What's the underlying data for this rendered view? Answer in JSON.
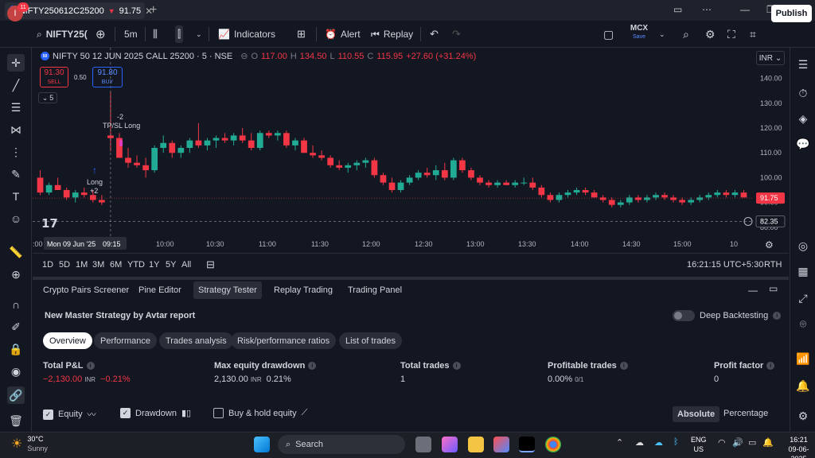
{
  "titlebar": {
    "tab_logo": "50",
    "tab_symbol": "NIFTY250612C25200",
    "tab_arrow": "▼",
    "tab_price": "91.75",
    "tab_close": "✕",
    "new_tab": "+"
  },
  "toolbar": {
    "avatar_letter": "I",
    "avatar_badge": "11",
    "symbol": "NIFTY25(",
    "interval": "5m",
    "indicators": "Indicators",
    "alert": "Alert",
    "replay": "Replay",
    "exchange": "MCX",
    "exchange_sub": "Save",
    "publish": "Publish"
  },
  "legend": {
    "logo": "50",
    "title": "NIFTY 50 12 JUN 2025 CALL 25200 · 5 · NSE",
    "o_label": "O",
    "o": "117.00",
    "h_label": "H",
    "h": "134.50",
    "l_label": "L",
    "l": "110.55",
    "c_label": "C",
    "c": "115.95",
    "change": "+27.60 (+31.24%)"
  },
  "trade": {
    "sell_price": "91.30",
    "sell_label": "SELL",
    "spread": "0.50",
    "buy_price": "91.80",
    "buy_label": "BUY",
    "collapse_count": "5"
  },
  "currency": "INR",
  "chart_data": {
    "type": "candlestick",
    "y_ticks": [
      "140.00",
      "130.00",
      "120.00",
      "110.00",
      "100.00",
      "90.00",
      "80.00"
    ],
    "x_ticks": [
      ":00",
      "Mon 09 Jun '25",
      "09:15",
      "10:00",
      "10:30",
      "11:00",
      "11:30",
      "12:00",
      "12:30",
      "13:00",
      "13:30",
      "14:00",
      "14:30",
      "15:00",
      "10"
    ],
    "ylim": [
      78,
      146
    ],
    "last_price": "91.75",
    "crosshair_price": "82.35",
    "annotations": {
      "tp_count": "-2",
      "tp_label": "TP/SL Long",
      "long_label": "Long",
      "long_count": "+2"
    },
    "candles": [
      [
        100,
        103,
        93,
        94
      ],
      [
        94,
        98,
        93,
        97
      ],
      [
        97,
        100,
        95,
        95
      ],
      [
        95,
        96,
        91,
        92
      ],
      [
        92,
        95,
        90,
        94
      ],
      [
        94,
        96,
        92,
        93
      ],
      [
        93,
        95,
        90,
        91
      ],
      [
        91,
        93,
        89,
        90
      ],
      [
        117,
        134.5,
        110.55,
        115.95
      ],
      [
        116,
        118,
        108,
        108
      ],
      [
        108,
        112,
        104,
        106
      ],
      [
        106,
        109,
        104,
        105
      ],
      [
        105,
        108,
        100,
        103
      ],
      [
        103,
        113,
        102,
        112
      ],
      [
        112,
        117,
        110,
        114
      ],
      [
        114,
        115,
        108,
        110
      ],
      [
        110,
        113,
        108,
        112
      ],
      [
        112,
        116,
        110,
        115
      ],
      [
        115,
        122,
        112,
        113
      ],
      [
        113,
        116,
        111,
        115
      ],
      [
        115,
        117,
        112,
        116
      ],
      [
        116,
        118,
        114,
        115
      ],
      [
        115,
        118,
        113,
        117
      ],
      [
        117,
        120,
        114,
        115
      ],
      [
        115,
        118,
        111,
        112
      ],
      [
        112,
        119,
        111,
        118
      ],
      [
        118,
        119,
        116,
        117
      ],
      [
        117,
        119,
        115,
        118
      ],
      [
        118,
        119,
        112,
        113
      ],
      [
        113,
        116,
        111,
        115
      ],
      [
        115,
        116,
        110,
        110
      ],
      [
        110,
        113,
        108,
        109
      ],
      [
        109,
        111,
        107,
        108
      ],
      [
        108,
        109,
        104,
        105
      ],
      [
        105,
        107,
        103,
        104
      ],
      [
        104,
        106,
        102,
        105
      ],
      [
        105,
        107,
        103,
        106
      ],
      [
        106,
        108,
        104,
        107
      ],
      [
        107,
        108,
        100,
        101
      ],
      [
        101,
        102,
        97,
        98
      ],
      [
        98,
        100,
        94,
        95
      ],
      [
        95,
        99,
        94,
        98
      ],
      [
        98,
        101,
        97,
        100
      ],
      [
        100,
        103,
        99,
        102
      ],
      [
        102,
        104,
        100,
        101
      ],
      [
        101,
        105,
        99,
        103
      ],
      [
        103,
        106,
        99,
        100
      ],
      [
        100,
        108,
        99,
        107
      ],
      [
        107,
        108,
        102,
        103
      ],
      [
        103,
        104,
        99,
        100
      ],
      [
        100,
        101,
        97,
        98
      ],
      [
        98,
        99,
        96,
        97
      ],
      [
        97,
        99,
        96,
        98
      ],
      [
        98,
        99,
        97,
        97
      ],
      [
        97,
        99,
        96,
        98
      ],
      [
        98,
        100,
        97,
        98
      ],
      [
        98,
        100,
        95,
        96
      ],
      [
        96,
        97,
        92,
        93
      ],
      [
        93,
        94,
        90,
        91
      ],
      [
        91,
        94,
        90,
        93
      ],
      [
        93,
        95,
        92,
        94
      ],
      [
        94,
        96,
        93,
        95
      ],
      [
        95,
        96,
        93,
        94
      ],
      [
        94,
        95,
        92,
        92
      ],
      [
        92,
        93,
        90,
        91
      ],
      [
        91,
        92,
        88,
        89
      ],
      [
        89,
        91,
        88,
        90
      ],
      [
        90,
        93,
        89,
        92
      ],
      [
        92,
        93,
        90,
        91
      ],
      [
        91,
        93,
        90,
        92
      ],
      [
        92,
        94,
        91,
        93
      ],
      [
        93,
        94,
        91,
        92
      ],
      [
        92,
        93,
        90,
        91
      ],
      [
        91,
        92,
        89,
        90
      ],
      [
        90,
        92,
        89,
        91
      ],
      [
        91,
        93,
        90,
        92
      ],
      [
        92,
        94,
        91,
        93
      ],
      [
        93,
        95,
        92,
        94
      ],
      [
        94,
        95,
        92,
        93
      ],
      [
        93,
        95,
        92,
        94
      ],
      [
        94,
        95,
        92,
        92
      ]
    ]
  },
  "range_bar": {
    "ranges": [
      "1D",
      "5D",
      "1M",
      "3M",
      "6M",
      "YTD",
      "1Y",
      "5Y",
      "All"
    ],
    "clock": "16:21:15 UTC+5:30",
    "rth": "RTH"
  },
  "panel": {
    "tabs": [
      "Crypto Pairs Screener",
      "Pine Editor",
      "Strategy Tester",
      "Replay Trading",
      "Trading Panel"
    ],
    "strategy_title": "New Master Strategy by Avtar report",
    "deep_backtesting": "Deep Backtesting",
    "subtabs": [
      "Overview",
      "Performance",
      "Trades analysis",
      "Risk/performance ratios",
      "List of trades"
    ],
    "metrics": {
      "pnl_label": "Total P&L",
      "pnl_value": "−2,130.00",
      "pnl_unit": "INR",
      "pnl_pct": "−0.21%",
      "dd_label": "Max equity drawdown",
      "dd_value": "2,130.00",
      "dd_unit": "INR",
      "dd_pct": "0.21%",
      "trades_label": "Total trades",
      "trades_value": "1",
      "profitable_label": "Profitable trades",
      "profitable_value": "0.00%",
      "profitable_sub": "0/1",
      "pf_label": "Profit factor",
      "pf_value": "0"
    },
    "checks": {
      "equity": "Equity",
      "drawdown": "Drawdown",
      "buyhold": "Buy & hold equity"
    },
    "absolute": "Absolute",
    "percentage": "Percentage"
  },
  "taskbar": {
    "temp": "30°C",
    "condition": "Sunny",
    "search": "Search",
    "lang1": "ENG",
    "lang2": "US",
    "time": "16:21",
    "date": "09-06-2025"
  }
}
